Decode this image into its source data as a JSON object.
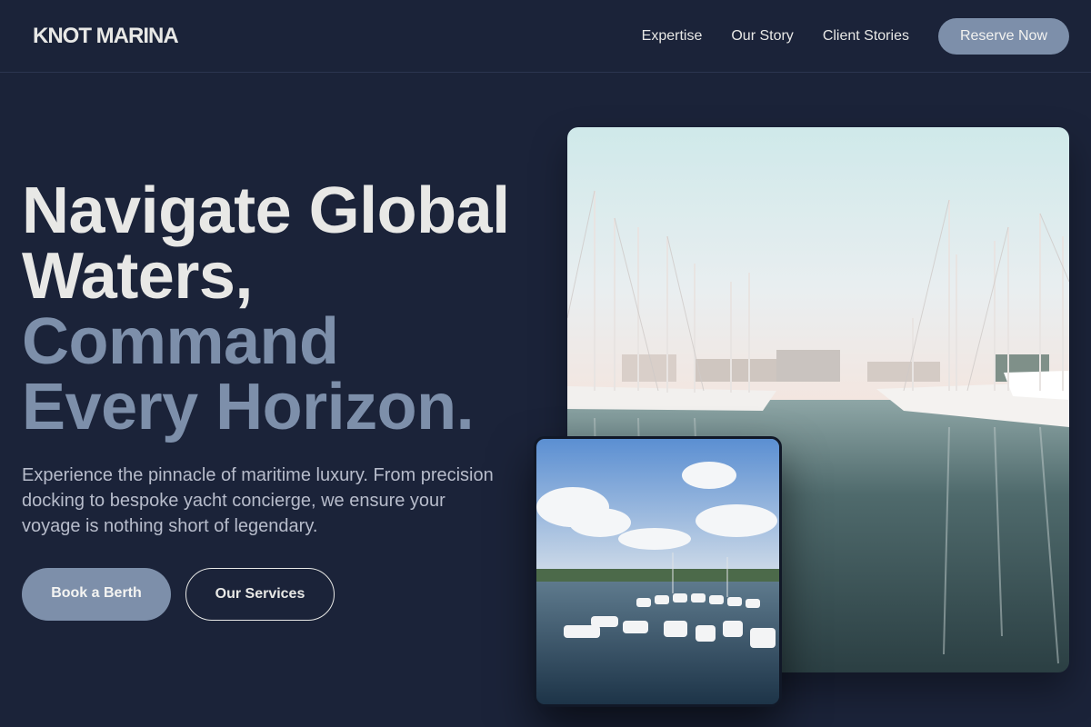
{
  "brand": {
    "name": "KNOT MARINA"
  },
  "nav": {
    "links": [
      "Expertise",
      "Our Story",
      "Client Stories"
    ],
    "cta": "Reserve Now"
  },
  "hero": {
    "title_line1": "Navigate Global",
    "title_line2": "Waters,",
    "title_line3": "Command",
    "title_line4": "Every Horizon.",
    "subtitle": "Experience the pinnacle of maritime luxury. From precision docking to bespoke yacht concierge, we ensure your voyage is nothing short of legendary.",
    "primary_button": "Book a Berth",
    "secondary_button": "Our Services"
  },
  "images": {
    "main": "marina-sailboats-photo",
    "secondary": "marina-motor-yachts-photo"
  },
  "colors": {
    "background": "#1b2339",
    "accent": "#7d8faa",
    "text": "#e8e8e6",
    "muted_text": "#b7bccb"
  }
}
